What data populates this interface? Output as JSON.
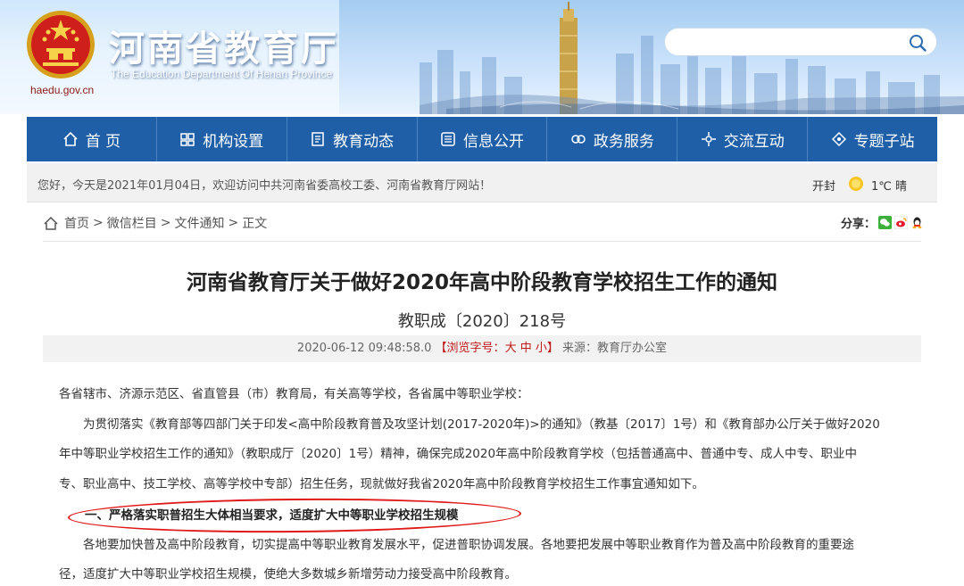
{
  "header": {
    "site_title": "河南省教育厅",
    "site_subtitle": "The Education Department Of Henan Province",
    "site_domain": "haedu.gov.cn",
    "search": {
      "placeholder": ""
    }
  },
  "nav": {
    "items": [
      {
        "label": "首 页",
        "icon": "home-icon"
      },
      {
        "label": "机构设置",
        "icon": "org-chart-icon"
      },
      {
        "label": "教育动态",
        "icon": "document-icon"
      },
      {
        "label": "信息公开",
        "icon": "notice-icon"
      },
      {
        "label": "政务服务",
        "icon": "service-icon"
      },
      {
        "label": "交流互动",
        "icon": "interaction-icon"
      },
      {
        "label": "专题子站",
        "icon": "topic-icon"
      }
    ]
  },
  "welcome": {
    "message": "您好，今天是2021年01月04日，欢迎访问中共河南省委高校工委、河南省教育厅网站！",
    "weather_city": "开封",
    "weather_temp": "1℃ 晴"
  },
  "breadcrumb": {
    "home": "首页",
    "sep1": ">",
    "level1": "微信栏目",
    "sep2": ">",
    "level2": "文件通知",
    "sep3": ">",
    "current": "正文"
  },
  "share": {
    "label": "分享："
  },
  "article": {
    "title": "河南省教育厅关于做好2020年高中阶段教育学校招生工作的通知",
    "doc_number": "教职成〔2020〕218号",
    "meta": {
      "datetime": "2020-06-12 09:48:58.0",
      "font_size_open": "【浏览字号：",
      "font_large": "大",
      "font_medium": "中",
      "font_small": "小",
      "font_size_close": "】",
      "source": "来源：教育厅办公室"
    },
    "paragraphs": [
      "各省辖市、济源示范区、省直管县（市）教育局，有关高等学校，各省属中等职业学校：",
      "为贯彻落实《教育部等四部门关于印发<高中阶段教育普及攻坚计划(2017-2020年)>的通知》（教基〔2017〕1号）和《教育部办公厅关于做好2020",
      "年中等职业学校招生工作的通知》（教职成厅〔2020〕1号）精神，确保完成2020年高中阶段教育学校（包括普通高中、普通中专、成人中专、职业中",
      "专、职业高中、技工学校、高等学校中专部）招生任务，现就做好我省2020年高中阶段教育学校招生工作事宜通知如下。",
      "一、严格落实职普招生大体相当要求，适度扩大中等职业学校招生规模",
      "各地要加快普及高中阶段教育，切实提高中等职业教育发展水平，促进普职协调发展。各地要把发展中等职业教育作为普及高中阶段教育的重要途",
      "径，适度扩大中等职业学校招生规模，使绝大多数城乡新增劳动力接受高中阶段教育。"
    ]
  },
  "colors": {
    "nav_bg": "#1f5fa7",
    "highlight_ellipse": "#e01818",
    "font_size_selector": "#c01b1b"
  }
}
